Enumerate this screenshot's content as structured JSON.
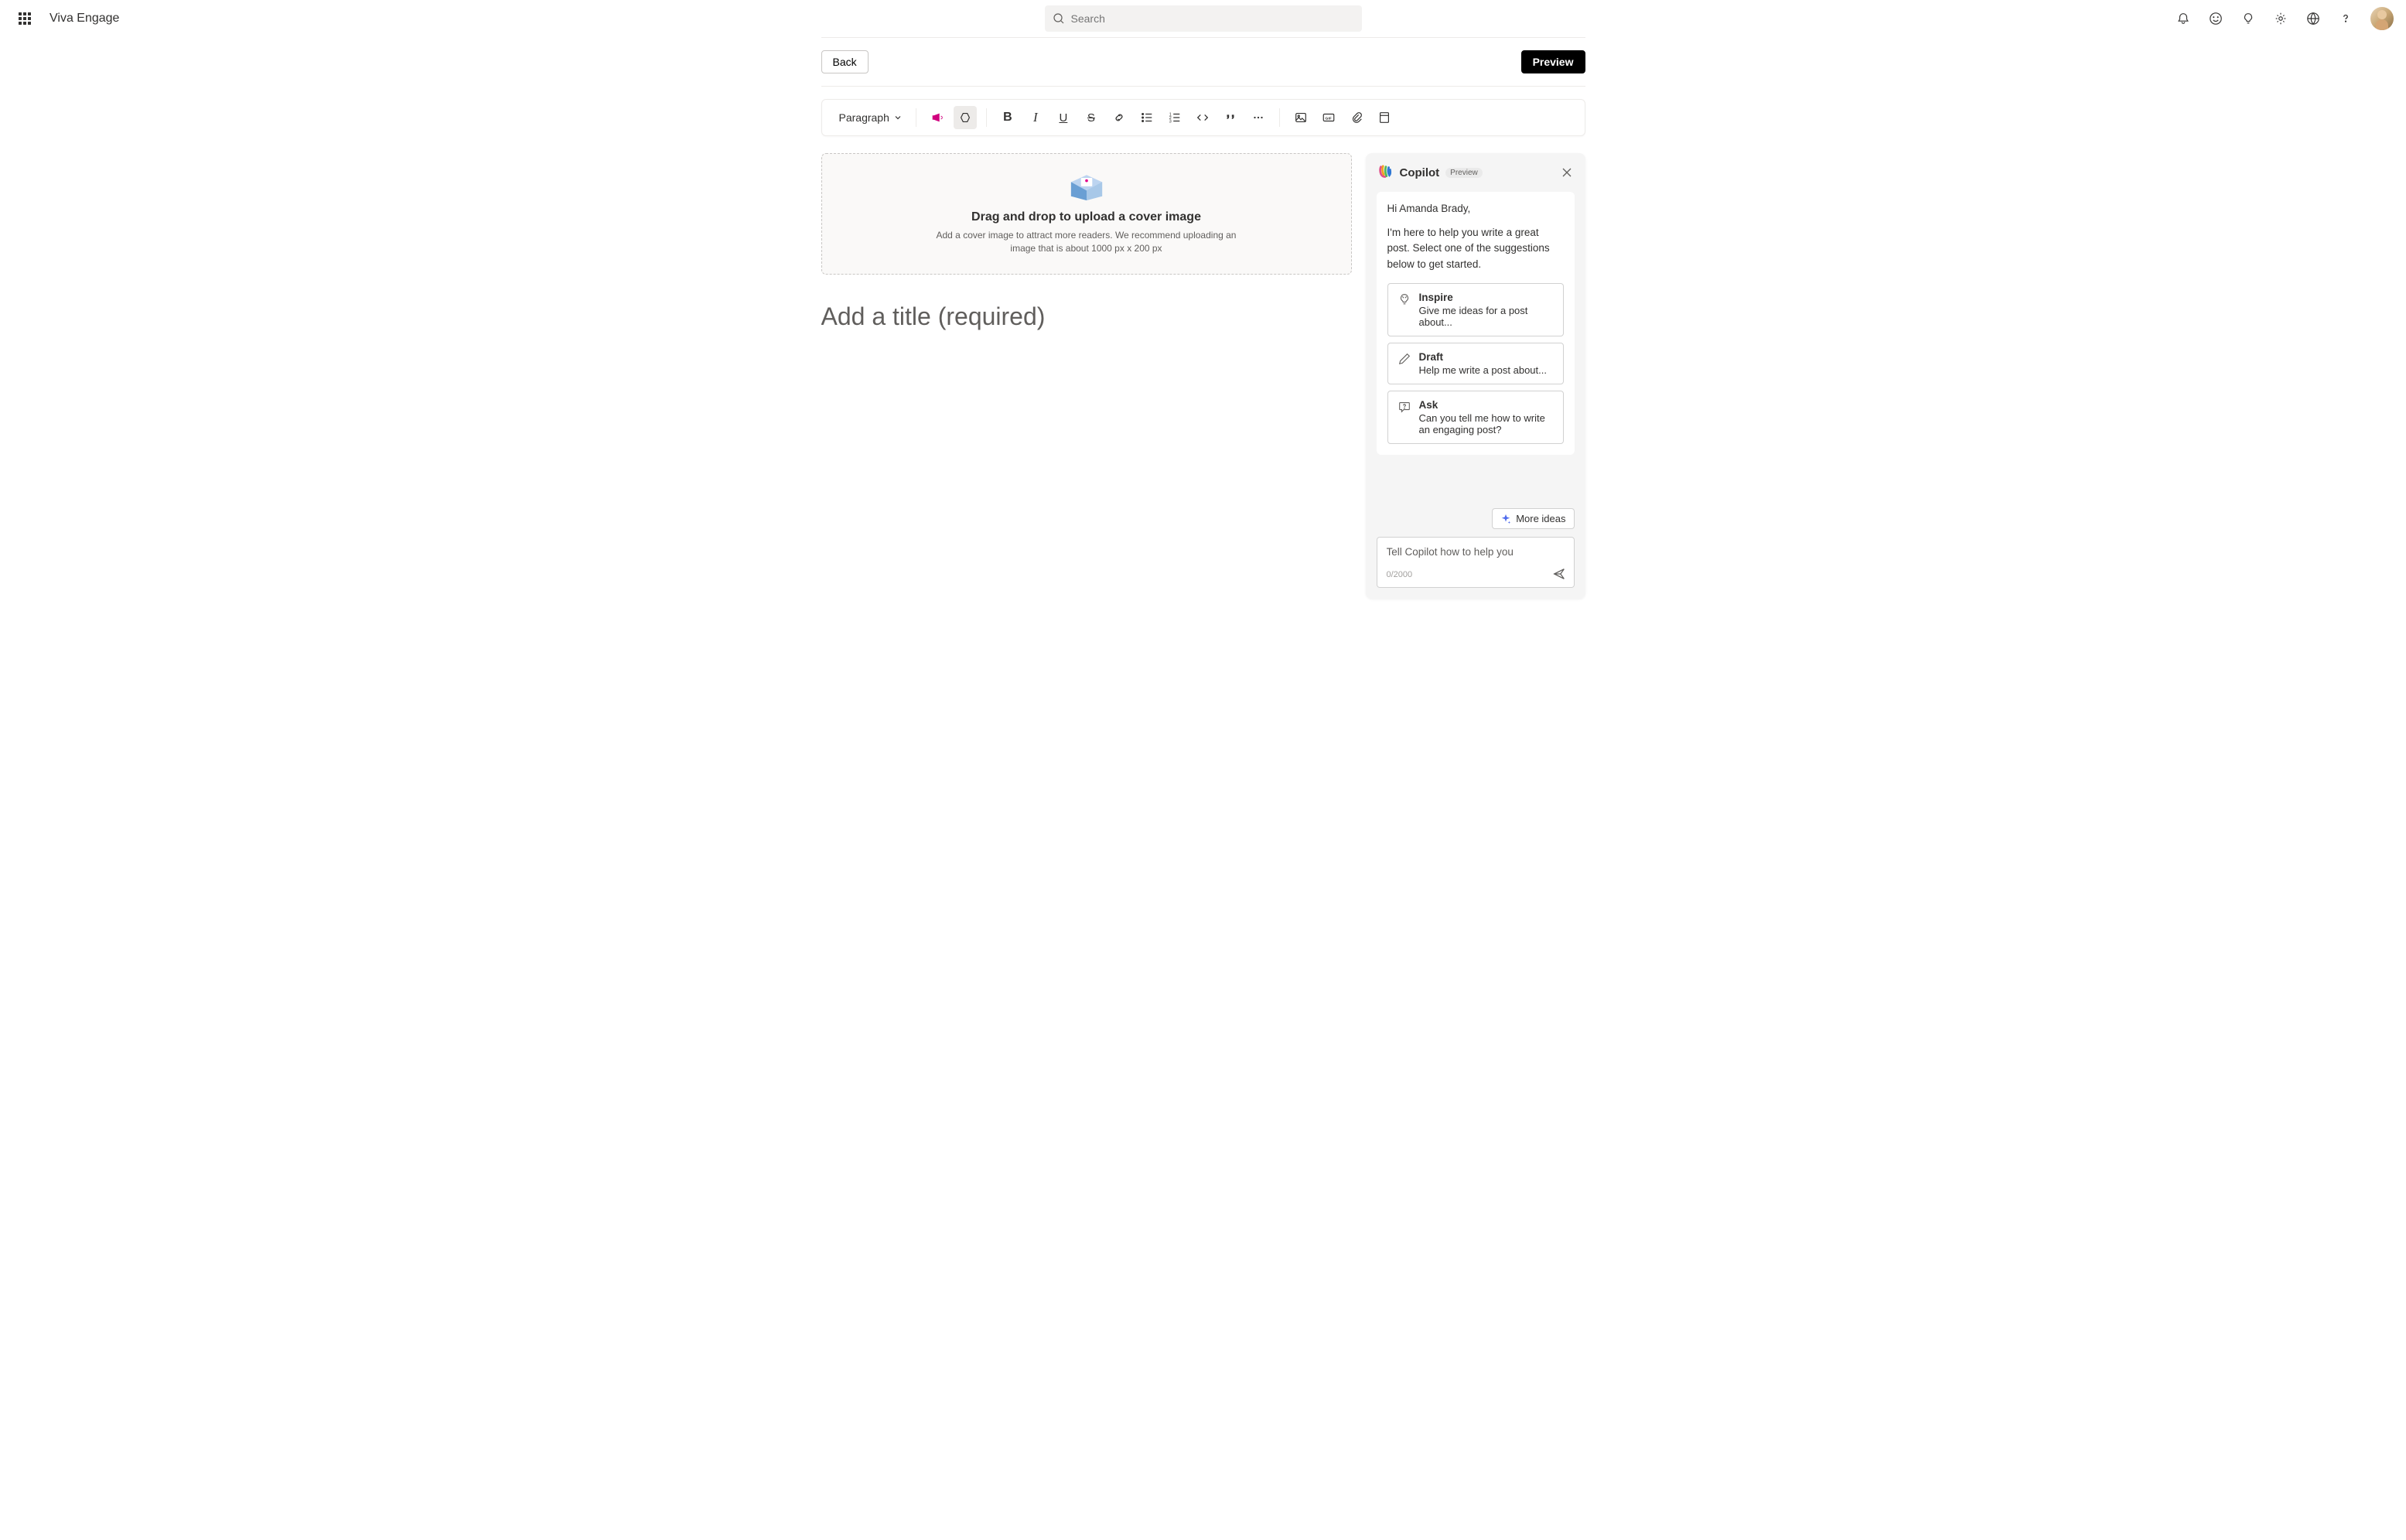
{
  "header": {
    "app_title": "Viva Engage",
    "search_placeholder": "Search"
  },
  "actions": {
    "back_label": "Back",
    "preview_label": "Preview"
  },
  "toolbar": {
    "style_label": "Paragraph"
  },
  "cover": {
    "title": "Drag and drop to upload a cover image",
    "subtitle": "Add a cover image to attract more readers. We recommend uploading an image that is about 1000 px x 200 px"
  },
  "editor": {
    "title_placeholder": "Add a title (required)"
  },
  "copilot": {
    "title": "Copilot",
    "badge": "Preview",
    "greeting": "Hi Amanda Brady,",
    "intro": "I'm here to help you write a great post. Select one of the suggestions below to get started.",
    "suggestions": [
      {
        "title": "Inspire",
        "desc": "Give me ideas for a post about..."
      },
      {
        "title": "Draft",
        "desc": "Help me write a post about..."
      },
      {
        "title": "Ask",
        "desc": "Can you tell me how to write an engaging post?"
      }
    ],
    "more_ideas_label": "More ideas",
    "input_placeholder": "Tell Copilot how to help you",
    "char_count": "0/2000"
  }
}
